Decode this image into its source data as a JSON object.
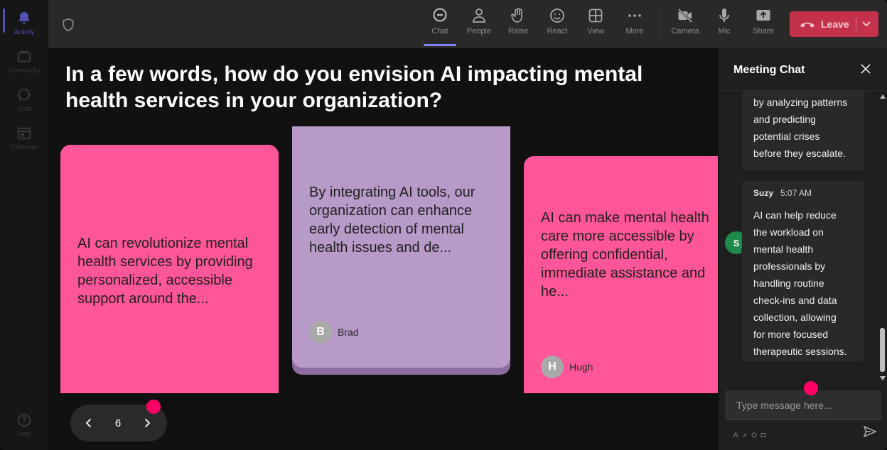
{
  "rail": {
    "items": [
      {
        "label": "Activity",
        "icon": "bell-icon"
      },
      {
        "label": "Community",
        "icon": "community-icon"
      },
      {
        "label": "Chat",
        "icon": "chat-icon"
      },
      {
        "label": "Calendar",
        "icon": "calendar-icon"
      },
      {
        "label": "Help",
        "icon": "help-icon"
      }
    ]
  },
  "toolbar": {
    "buttons": [
      {
        "label": "Chat",
        "icon": "chat-icon"
      },
      {
        "label": "People",
        "icon": "people-icon"
      },
      {
        "label": "Raise",
        "icon": "hand-icon"
      },
      {
        "label": "React",
        "icon": "smile-icon"
      },
      {
        "label": "View",
        "icon": "grid-icon"
      },
      {
        "label": "More",
        "icon": "more-icon"
      },
      {
        "label": "Camera",
        "icon": "camera-off-icon"
      },
      {
        "label": "Mic",
        "icon": "mic-icon"
      },
      {
        "label": "Share",
        "icon": "share-icon"
      }
    ],
    "leave_label": "Leave",
    "colors": {
      "leave": "#c4314b",
      "active_underline": "#7f85f5"
    }
  },
  "stage": {
    "question": "In a few words, how do you envision AI impacting mental health services in your organization?",
    "cards": [
      {
        "text": "AI can revolutionize mental health services by providing personalized, accessible support around the...",
        "author": "",
        "initial": "",
        "color": "#ff5599"
      },
      {
        "text": "By integrating AI tools, our organization can enhance early detection of mental health issues and de...",
        "author": "Brad",
        "initial": "B",
        "color": "#b79ac8"
      },
      {
        "text": "AI can make mental health care more accessible by offering confidential, immediate assistance and he...",
        "author": "Hugh",
        "initial": "H",
        "color": "#ff5599"
      }
    ],
    "pager": {
      "page": "6"
    }
  },
  "chat": {
    "title": "Meeting Chat",
    "messages": [
      {
        "sender": "",
        "time": "",
        "text_lines": [
          "by analyzing patterns",
          "and predicting",
          "potential crises",
          "before they escalate."
        ]
      },
      {
        "sender": "Suzy",
        "initial": "S",
        "time": "5:07 AM",
        "text_lines": [
          "AI can help reduce",
          "the workload on",
          "mental health",
          "professionals by",
          "handling routine",
          "check-ins and data",
          "collection, allowing",
          "for more focused",
          "therapeutic sessions."
        ]
      }
    ],
    "compose_placeholder": "Type message here...",
    "avatar_color": "#1f8a4c"
  },
  "accent": "#ff0066"
}
